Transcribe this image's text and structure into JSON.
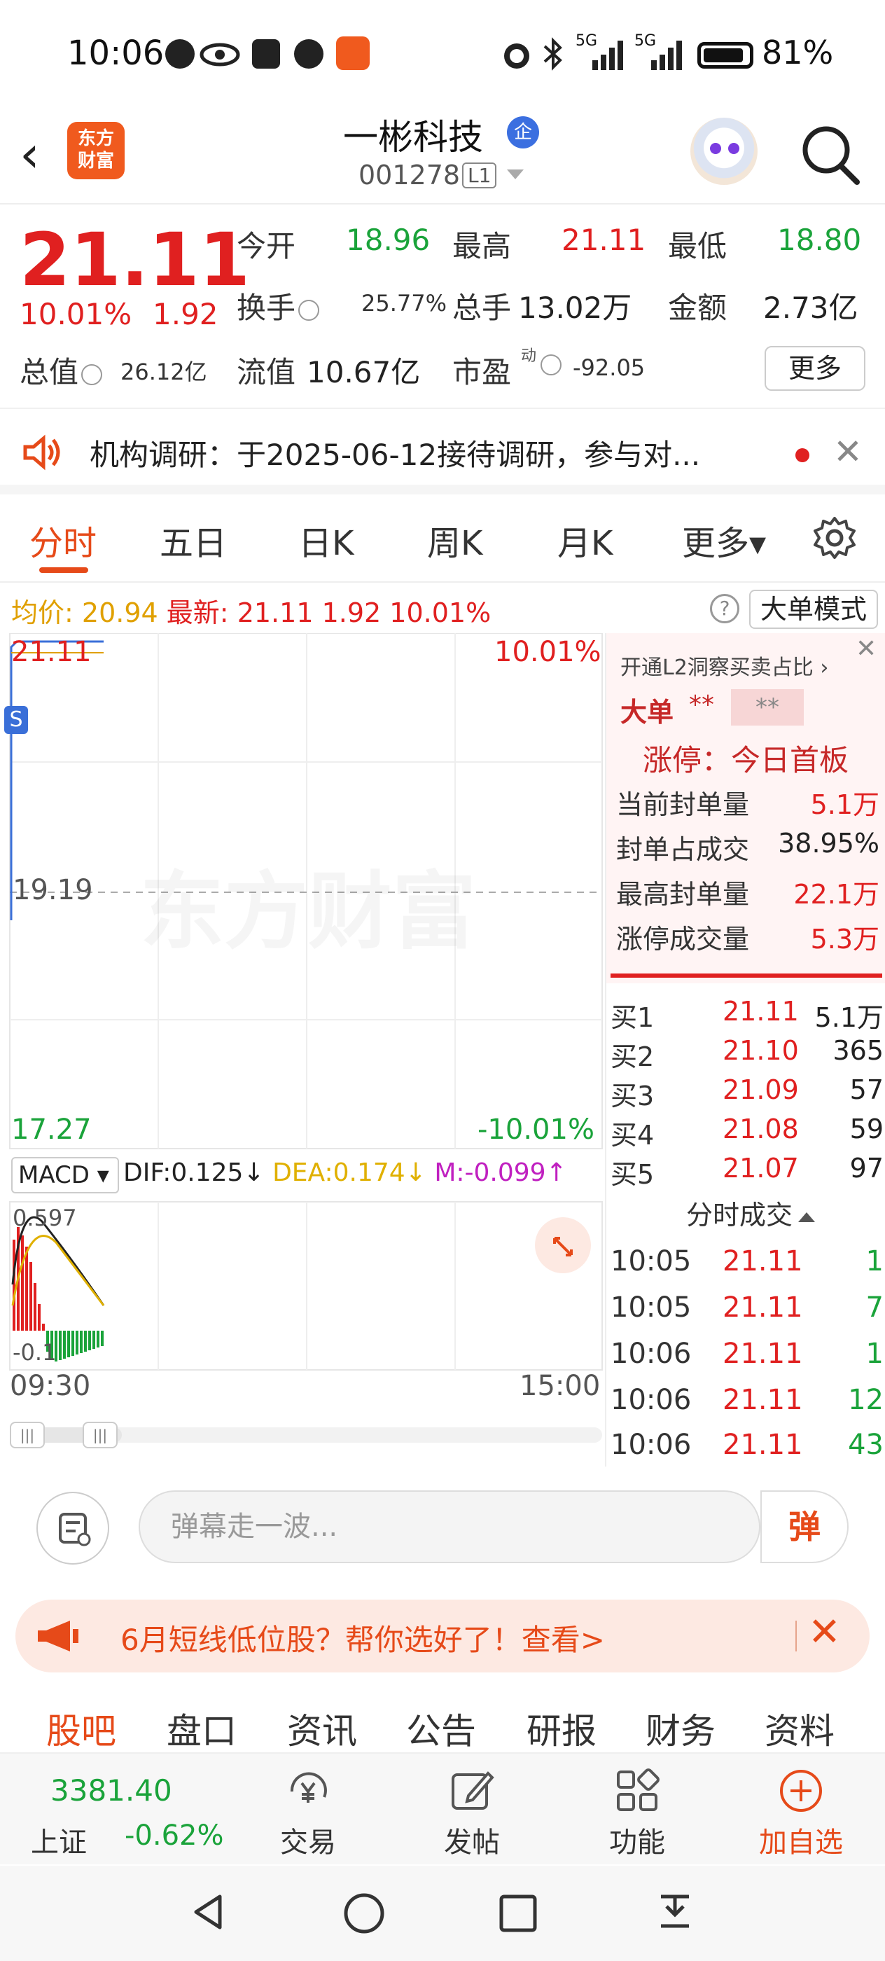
{
  "status_bar": {
    "time": "10:06",
    "battery": "81%",
    "signal1": "5G",
    "signal2": "5G"
  },
  "header": {
    "app_logo": "东方\n财富",
    "stock_name": "一彬科技",
    "enterprise_badge": "企",
    "stock_code": "001278",
    "level_badge": "L1"
  },
  "quote": {
    "price": "21.11",
    "change_pct": "10.01%",
    "change": "1.92",
    "open_label": "今开",
    "open": "18.96",
    "high_label": "最高",
    "high": "21.11",
    "low_label": "最低",
    "low": "18.80",
    "turnover_label": "换手",
    "turnover": "25.77%",
    "volume_label": "总手",
    "volume": "13.02万",
    "amount_label": "金额",
    "amount": "2.73亿",
    "market_cap_label": "总值",
    "market_cap": "26.12亿",
    "float_cap_label": "流值",
    "float_cap": "10.67亿",
    "pe_label": "市盈",
    "pe_sup": "动",
    "pe": "-92.05",
    "more_button": "更多"
  },
  "notice": {
    "text": "机构调研：于2025-06-12接待调研，参与对..."
  },
  "chart_tabs": [
    {
      "label": "分时",
      "active": true
    },
    {
      "label": "五日",
      "active": false
    },
    {
      "label": "日K",
      "active": false
    },
    {
      "label": "周K",
      "active": false
    },
    {
      "label": "月K",
      "active": false
    },
    {
      "label": "更多▾",
      "active": false
    }
  ],
  "avg_line": {
    "avg_label": "均价:",
    "avg": "20.94",
    "latest_label": "最新:",
    "latest": "21.11",
    "latest_change": "1.92",
    "latest_pct": "10.01%",
    "help": "?",
    "big_order_mode": "大单模式"
  },
  "chart": {
    "y_top": "21.11",
    "y_mid": "19.19",
    "y_bottom": "17.27",
    "pct_top": "10.01%",
    "pct_bottom": "-10.01%",
    "watermark": "东方财富",
    "s_marker": "S",
    "x_start": "09:30",
    "x_end": "15:00",
    "macd_label": "MACD ▾",
    "dif": "DIF:0.125↓",
    "dea": "DEA:0.174↓",
    "m": "M:-0.099↑",
    "macd_top": "0.597",
    "macd_bottom": "-0.1"
  },
  "side_panel": {
    "l2_link": "开通L2洞察买卖占比 ›",
    "big_order_label": "大单",
    "big_order_v1": "**",
    "big_order_v2": "**",
    "limit_title": "涨停：今日首板",
    "stats": [
      {
        "label": "当前封单量",
        "value": "5.1万",
        "color": "red"
      },
      {
        "label": "封单占成交",
        "value": "38.95%",
        "color": "dark"
      },
      {
        "label": "最高封单量",
        "value": "22.1万",
        "color": "red"
      },
      {
        "label": "涨停成交量",
        "value": "5.3万",
        "color": "red"
      }
    ],
    "order_book": [
      {
        "level": "买1",
        "price": "21.11",
        "volume": "5.1万"
      },
      {
        "level": "买2",
        "price": "21.10",
        "volume": "365"
      },
      {
        "level": "买3",
        "price": "21.09",
        "volume": "57"
      },
      {
        "level": "买4",
        "price": "21.08",
        "volume": "59"
      },
      {
        "level": "买5",
        "price": "21.07",
        "volume": "97"
      }
    ],
    "trades_header": "分时成交",
    "trades": [
      {
        "time": "10:05",
        "price": "21.11",
        "volume": "1"
      },
      {
        "time": "10:05",
        "price": "21.11",
        "volume": "7"
      },
      {
        "time": "10:06",
        "price": "21.11",
        "volume": "1"
      },
      {
        "time": "10:06",
        "price": "21.11",
        "volume": "12"
      },
      {
        "time": "10:06",
        "price": "21.11",
        "volume": "43"
      }
    ]
  },
  "danmu": {
    "placeholder": "弹幕走一波...",
    "send": "弹"
  },
  "promo": {
    "text": "6月短线低位股？帮你选好了！查看>"
  },
  "info_tabs": [
    {
      "label": "股吧",
      "active": true
    },
    {
      "label": "盘口",
      "active": false
    },
    {
      "label": "资讯",
      "active": false
    },
    {
      "label": "公告",
      "active": false
    },
    {
      "label": "研报",
      "active": false
    },
    {
      "label": "财务",
      "active": false
    },
    {
      "label": "资料",
      "active": false
    }
  ],
  "toolbar": {
    "index_value": "3381.40",
    "index_name": "上证",
    "index_change": "-0.62%",
    "items": [
      {
        "label": "交易",
        "icon": "yuan-exchange-icon"
      },
      {
        "label": "发帖",
        "icon": "edit-post-icon"
      },
      {
        "label": "功能",
        "icon": "grid-apps-icon"
      },
      {
        "label": "加自选",
        "icon": "add-circle-icon"
      }
    ]
  },
  "colors": {
    "up_red": "#e02020",
    "down_green": "#1aa33a",
    "accent_orange": "#e64a19",
    "avg_yellow": "#e0a000"
  }
}
